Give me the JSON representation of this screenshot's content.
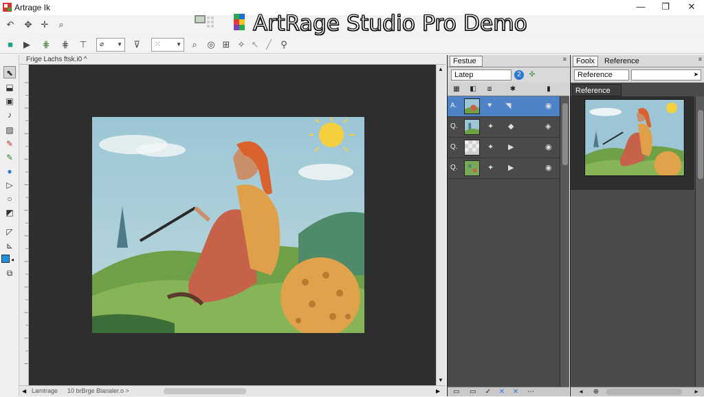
{
  "window": {
    "title": "Artrage Ik",
    "banner_title": "ArtRage Studio Pro Demo",
    "minimize_glyph": "—",
    "maximize_glyph": "❐",
    "close_glyph": "✕"
  },
  "toolbar": {
    "brush_size_value": "",
    "layer_mode_value": ""
  },
  "document": {
    "tab_label": "Frige Lachs ftsk.i0 ^",
    "status_left": "Lamtrage",
    "status_right": "10 brBrge Blanaler.o >"
  },
  "layers_panel": {
    "tab_label": "Festue",
    "blend_mode": "Latep",
    "menu_glyph": "≡",
    "layers": [
      {
        "letter": "A.",
        "active": true
      },
      {
        "letter": "Q.",
        "active": false
      },
      {
        "letter": "Q.",
        "active": false
      },
      {
        "letter": "Q.",
        "active": false
      }
    ]
  },
  "reference_panel": {
    "tab_tools": "Foolx",
    "tab_reference": "Reference",
    "select_value": "Reference",
    "section_label": "Reference",
    "menu_glyph": "≡"
  },
  "colors": {
    "active_layer": "#4f83c7",
    "canvas_bg": "#2e2e2e",
    "panel_bg": "#4a4a4a"
  }
}
